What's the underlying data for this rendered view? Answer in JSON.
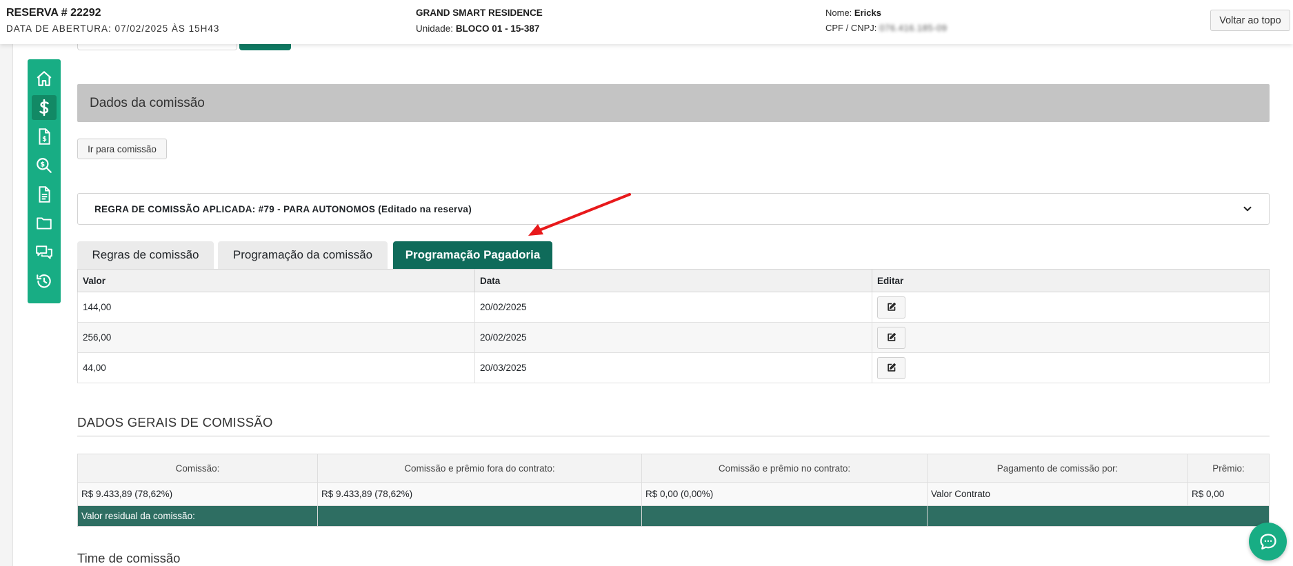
{
  "header": {
    "reservation_title": "RESERVA # 22292",
    "opening_date": "DATA DE ABERTURA: 07/02/2025 ÀS 15H43",
    "enterprise": "GRAND SMART RESIDENCE",
    "unit_label": "Unidade:",
    "unit_value": "BLOCO 01 - 15-387",
    "name_label": "Nome:",
    "name_value": "Ericks",
    "cpf_label": "CPF / CNPJ:",
    "cpf_value": "076.416.185-09",
    "back_to_top": "Voltar ao topo"
  },
  "sidebar": {
    "items": [
      {
        "icon": "home-icon",
        "active": false
      },
      {
        "icon": "dollar-icon",
        "active": true
      },
      {
        "icon": "invoice-dollar-icon",
        "active": false
      },
      {
        "icon": "search-dollar-icon",
        "active": false
      },
      {
        "icon": "document-icon",
        "active": false
      },
      {
        "icon": "folder-icon",
        "active": false
      },
      {
        "icon": "comments-icon",
        "active": false
      },
      {
        "icon": "history-icon",
        "active": false
      }
    ]
  },
  "commission": {
    "section_title": "Dados da comissão",
    "go_button": "Ir para comissão",
    "rule_applied": "REGRA DE COMISSÃO APLICADA: #79 - PARA AUTONOMOS (Editado na reserva)"
  },
  "tabs": [
    {
      "label": "Regras de comissão",
      "active": false
    },
    {
      "label": "Programação da comissão",
      "active": false
    },
    {
      "label": "Programação Pagadoria",
      "active": true
    }
  ],
  "payment_table": {
    "headers": [
      "Valor",
      "Data",
      "Editar"
    ],
    "rows": [
      {
        "valor": "144,00",
        "data": "20/02/2025"
      },
      {
        "valor": "256,00",
        "data": "20/02/2025"
      },
      {
        "valor": "44,00",
        "data": "20/03/2025"
      }
    ]
  },
  "general": {
    "title": "DADOS GERAIS DE COMISSÃO",
    "headers": [
      "Comissão:",
      "Comissão e prêmio fora do contrato:",
      "Comissão e prêmio no contrato:",
      "Pagamento de comissão por:",
      "Prêmio:"
    ],
    "row": [
      "R$ 9.433,89 (78,62%)",
      "R$ 9.433,89 (78,62%)",
      "R$ 0,00 (0,00%)",
      "Valor Contrato",
      "R$ 0,00"
    ],
    "residual_label": "Valor residual da comissão:"
  },
  "team_title": "Time de comissão",
  "colors": {
    "accent": "#18ad84",
    "accent_dark": "#0f6b5a",
    "annotation": "#e8191b"
  }
}
